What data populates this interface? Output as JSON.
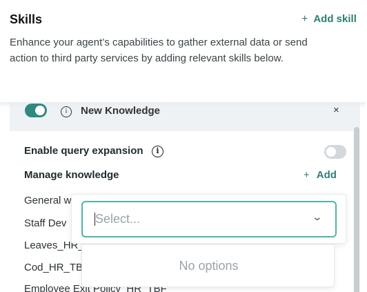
{
  "header": {
    "title": "Skills",
    "add_skill_plus": "+",
    "add_skill_label": "Add skill",
    "description": "Enhance your agent’s capabilities to gather external data or send action to third party services by adding relevant skills below."
  },
  "skill_panel": {
    "name": "New Knowledge",
    "close": "×",
    "enabled": true,
    "query_expansion_label": "Enable query expansion",
    "query_expansion_enabled": false,
    "info_glyph": "i",
    "manage_label": "Manage knowledge",
    "add_plus": "+",
    "add_label": "Add",
    "knowledge_items": [
      "General w",
      "Staff Dev",
      "Leaves_HR_",
      "Cod_HR_TB",
      "Employee Exit Policy_HR_TBF"
    ]
  },
  "dropdown": {
    "placeholder": "Select...",
    "chevron": "⌄",
    "no_options": "No options"
  },
  "colors": {
    "accent": "#2e7d75",
    "focus_border": "#4fb3a6",
    "toggle_on": "#2e8a80",
    "toggle_off": "#d4d8db"
  },
  "icons": [
    "plus-icon",
    "info-icon",
    "close-icon",
    "chevron-down-icon"
  ]
}
